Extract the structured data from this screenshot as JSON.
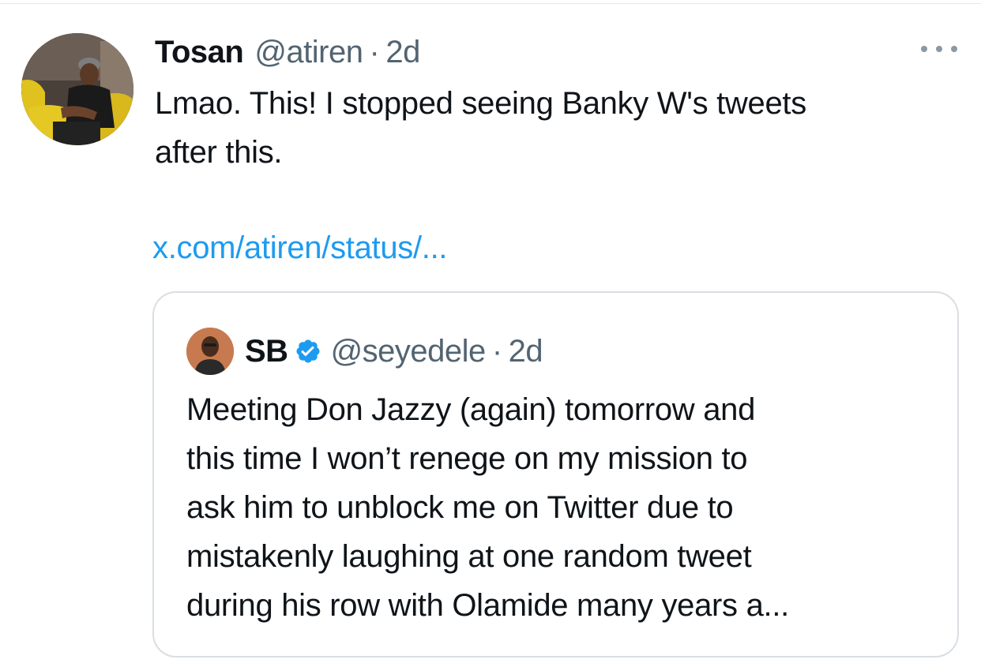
{
  "tweet": {
    "author_name": "Tosan",
    "author_handle": "@atiren",
    "separator": "·",
    "time": "2d",
    "text_line1": "Lmao. This! I stopped seeing Banky W's tweets",
    "text_line2": "after this.",
    "link": "x.com/atiren/status/..."
  },
  "quoted_tweet": {
    "author_name": "SB",
    "author_handle": "@seyedele",
    "separator": "·",
    "time": "2d",
    "lines": [
      "Meeting Don Jazzy (again) tomorrow and",
      "this time I won’t renege on my mission to",
      "ask him to unblock me on Twitter due to",
      "mistakenly laughing at one random tweet",
      "during his row with Olamide many years a..."
    ]
  },
  "icons": {
    "more": "more-horizontal-icon",
    "verified": "verified-badge-icon"
  },
  "colors": {
    "link": "#1d9bf0",
    "verified": "#1d9bf0",
    "secondary_text": "#536471",
    "border": "#d9dee2"
  }
}
